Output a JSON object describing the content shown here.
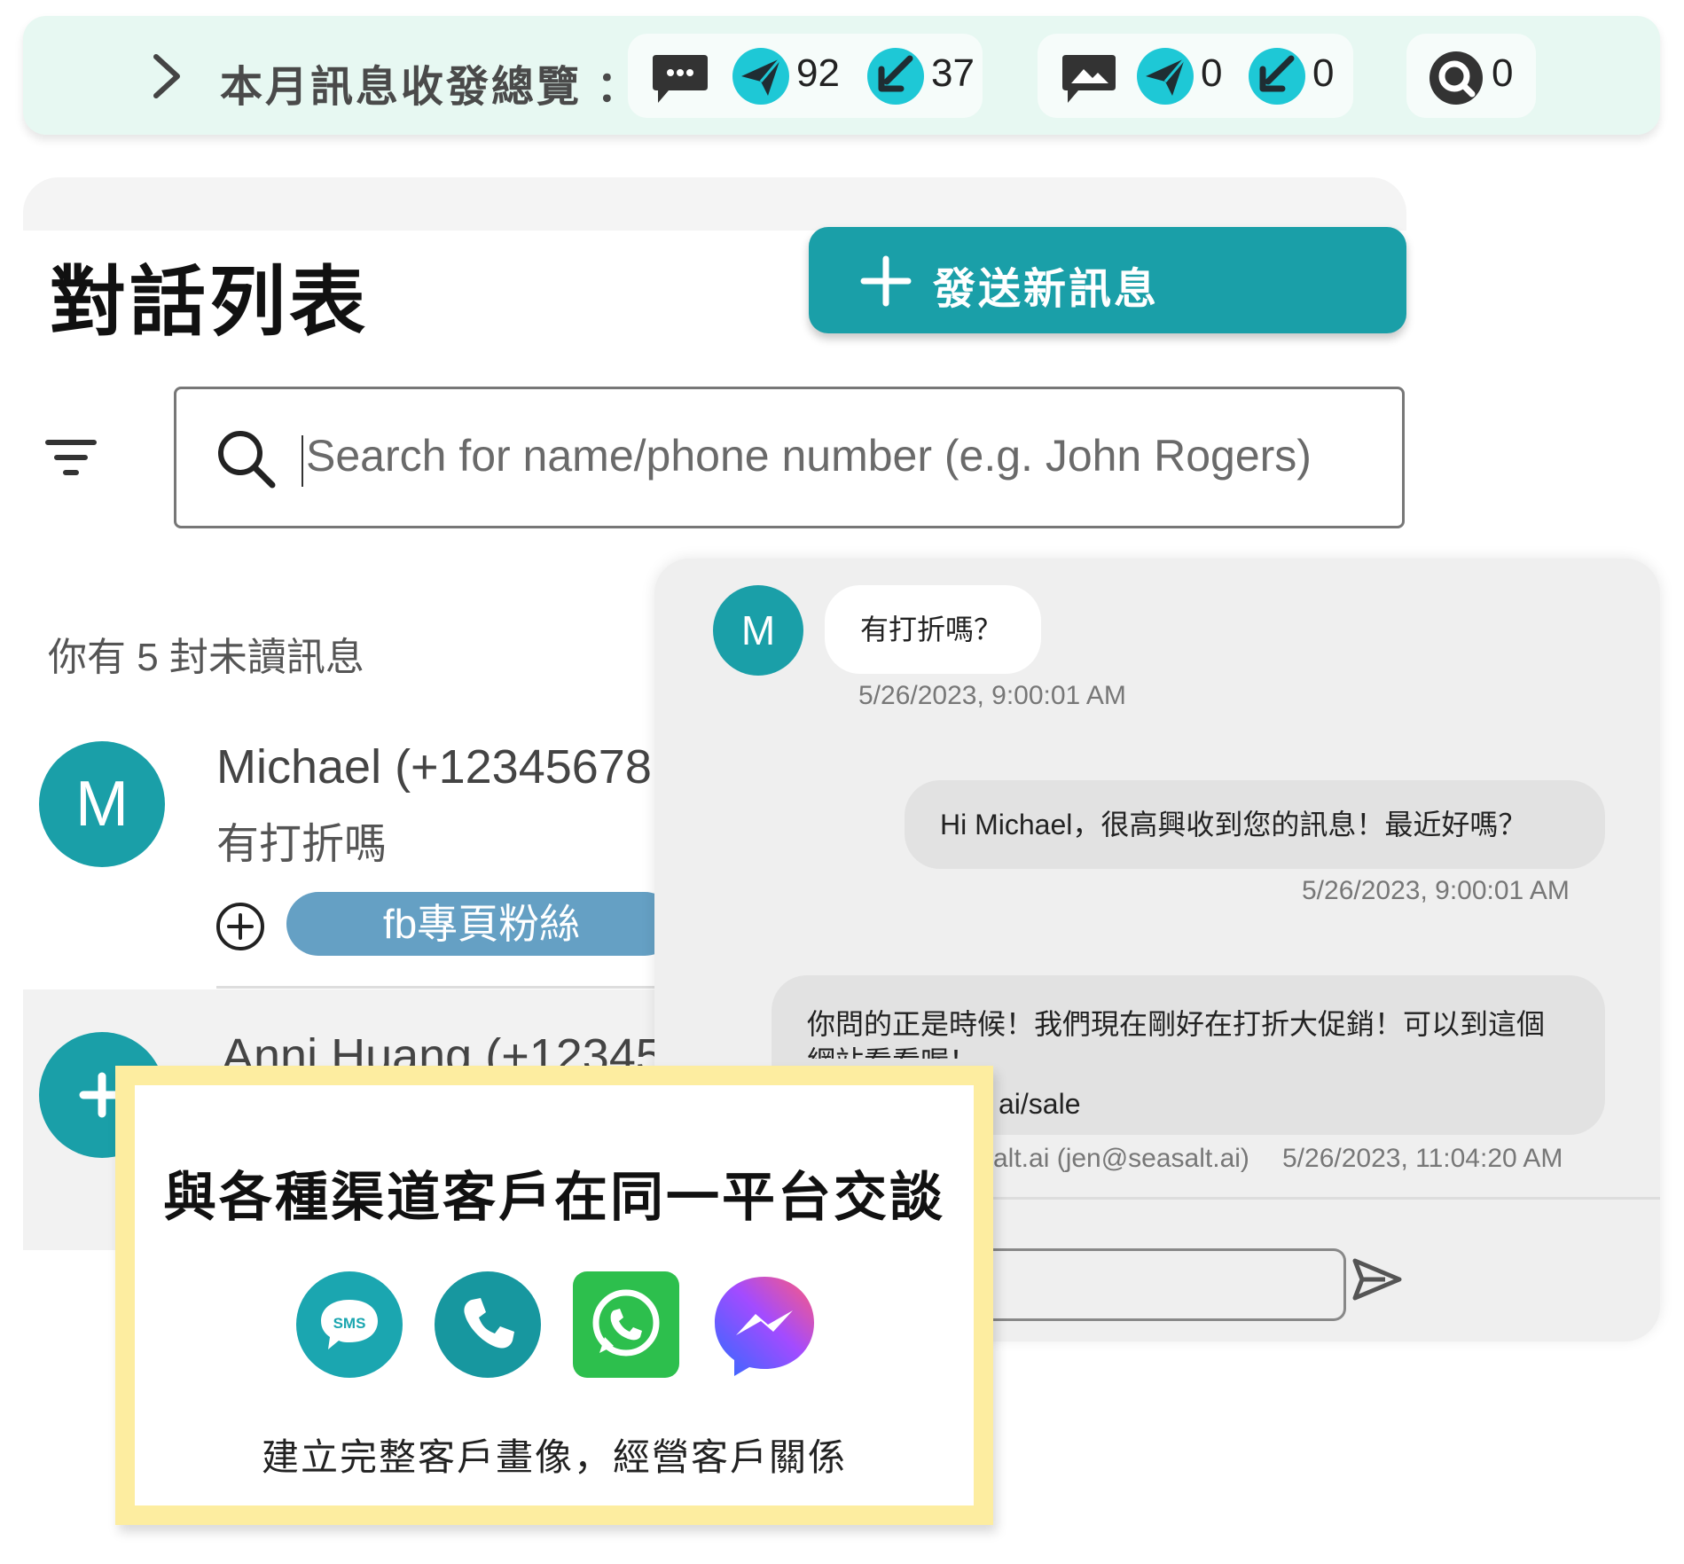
{
  "stats": {
    "title": "本月訊息收發總覽 ：",
    "sms": {
      "sent": "92",
      "received": "37"
    },
    "mms": {
      "sent": "0",
      "received": "0"
    },
    "lookup": {
      "count": "0"
    }
  },
  "list": {
    "title": "對話列表",
    "new_message_label": "發送新訊息",
    "search_placeholder": "Search for name/phone number (e.g. John Rogers)",
    "unread_text": "你有 5 封未讀訊息",
    "contacts": [
      {
        "avatar": "M",
        "name": "Michael (+12345678",
        "preview": "有打折嗎",
        "tag": "fb專頁粉絲"
      },
      {
        "name": "Anni Huang (+12345"
      }
    ]
  },
  "chat": {
    "avatar": "M",
    "messages": [
      {
        "text": "有打折嗎？",
        "time": "5/26/2023, 9:00:01 AM"
      },
      {
        "text": "Hi Michael，很高興收到您的訊息！最近好嗎？",
        "time": "5/26/2023, 9:00:01 AM"
      },
      {
        "text": "你問的正是時候！我們現在剛好在打折大促銷！可以到這個網站看看喔！",
        "url_fragment": "ai/sale",
        "sender": "alt.ai (jen@seasalt.ai)",
        "time": "5/26/2023, 11:04:20 AM"
      }
    ]
  },
  "feature": {
    "title": "與各種渠道客戶在同一平台交談",
    "sms_badge": "SMS",
    "subtitle": "建立完整客戶畫像，經營客戶關係"
  },
  "colors": {
    "teal": "#1a9fa8",
    "cyan": "#1ec8d6",
    "mint_bar": "#e7f8f2",
    "tag_blue": "#65a0c4",
    "card_border": "#fdeda0",
    "whatsapp_green": "#2dbf4d",
    "messenger_gradient": [
      "#2f6bff",
      "#a34bff",
      "#ff5b7a"
    ]
  },
  "icons": [
    "chevron-right-icon",
    "sms-bubble-icon",
    "send-plane-icon",
    "receive-arrow-icon",
    "image-icon",
    "lookup-icon",
    "plus-icon",
    "filter-icon",
    "search-icon",
    "add-circle-icon",
    "send-icon",
    "phone-icon",
    "whatsapp-icon",
    "messenger-icon"
  ]
}
